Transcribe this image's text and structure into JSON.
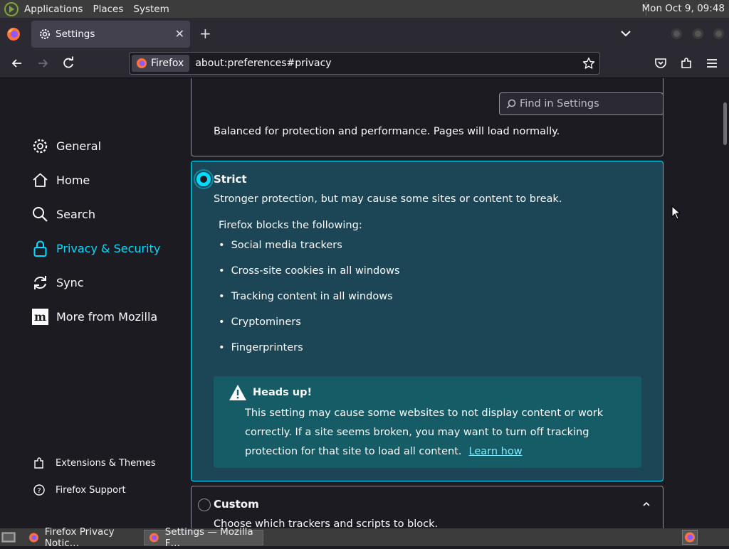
{
  "system_bar": {
    "menus": [
      "Applications",
      "Places",
      "System"
    ],
    "clock": "Mon Oct  9, 09:48"
  },
  "browser": {
    "tab_title": "Settings",
    "url_identity": "Firefox",
    "url": "about:preferences#privacy"
  },
  "settings": {
    "search_placeholder": "Find in Settings",
    "categories": [
      {
        "label": "General",
        "icon": "gear-icon"
      },
      {
        "label": "Home",
        "icon": "home-icon"
      },
      {
        "label": "Search",
        "icon": "search-icon"
      },
      {
        "label": "Privacy & Security",
        "icon": "lock-icon",
        "active": true
      },
      {
        "label": "Sync",
        "icon": "sync-icon"
      },
      {
        "label": "More from Mozilla",
        "icon": "mozilla-icon"
      }
    ],
    "footer": {
      "extensions": "Extensions & Themes",
      "support": "Firefox Support"
    },
    "standard_desc": "Balanced for protection and performance. Pages will load normally.",
    "strict": {
      "label": "Strict",
      "desc": "Stronger protection, but may cause some sites or content to break.",
      "blocks_title": "Firefox blocks the following:",
      "items": [
        "Social media trackers",
        "Cross-site cookies in all windows",
        "Tracking content in all windows",
        "Cryptominers",
        "Fingerprinters"
      ],
      "headsup_title": "Heads up!",
      "headsup_text": "This setting may cause some websites to not display content or work correctly. If a site seems broken, you may want to turn off tracking protection for that site to load all content.",
      "learn_how": "Learn how"
    },
    "custom": {
      "label": "Custom",
      "desc": "Choose which trackers and scripts to block."
    }
  },
  "taskbar": {
    "tasks": [
      "Firefox Privacy Notic…",
      "Settings — Mozilla F…"
    ]
  },
  "colors": {
    "accent": "#00ddff",
    "strict_bg": "#1c4656",
    "headsup_bg": "#155c66",
    "page_bg": "#1c1b22"
  }
}
